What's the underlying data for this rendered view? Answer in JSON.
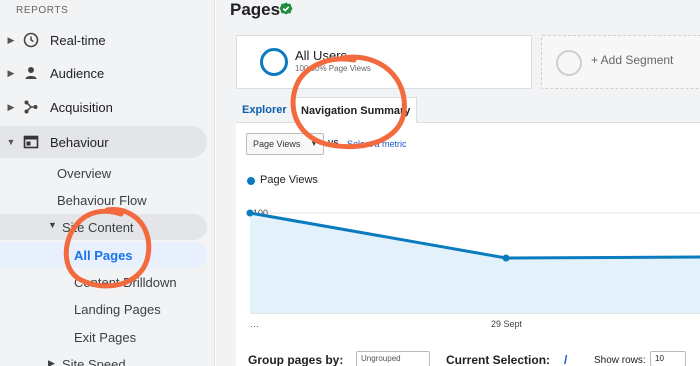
{
  "sidebar": {
    "section_label": "REPORTS",
    "items": [
      {
        "label": "Real-time",
        "icon": "clock-icon"
      },
      {
        "label": "Audience",
        "icon": "person-icon"
      },
      {
        "label": "Acquisition",
        "icon": "acquisition-icon"
      },
      {
        "label": "Behaviour",
        "icon": "behaviour-icon"
      }
    ],
    "behaviour_children": [
      {
        "label": "Overview"
      },
      {
        "label": "Behaviour Flow"
      },
      {
        "label": "Site Content"
      },
      {
        "label": "All Pages"
      },
      {
        "label": "Content Drilldown"
      },
      {
        "label": "Landing Pages"
      },
      {
        "label": "Exit Pages"
      },
      {
        "label": "Site Speed"
      }
    ]
  },
  "main": {
    "title": "Pages",
    "segment": {
      "name": "All Users",
      "sub": "100.00% Page Views"
    },
    "add_segment": "+ Add Segment",
    "tabs": [
      {
        "label": "Explorer"
      },
      {
        "label": "Navigation Summary"
      }
    ],
    "metric_select": "Page Views",
    "vs": "VS",
    "select_metric": "Select a metric",
    "legend": "Page Views",
    "bottom": {
      "group_by": "Group pages by:",
      "group_value": "Ungrouped",
      "current_selection": "Current Selection:",
      "current_value": "/",
      "show_rows": "Show rows:",
      "rows_value": "10"
    }
  },
  "colors": {
    "accent": "#0b7bbf",
    "annotation": "#f26a3d",
    "check": "#1e8e3e"
  },
  "chart_data": {
    "type": "area",
    "x": [
      "…",
      "29 Sept",
      ""
    ],
    "series": [
      {
        "values": [
          100,
          55,
          56
        ]
      }
    ],
    "y_ticks": [
      100,
      50
    ],
    "ylim": [
      0,
      110
    ],
    "grid": true
  }
}
